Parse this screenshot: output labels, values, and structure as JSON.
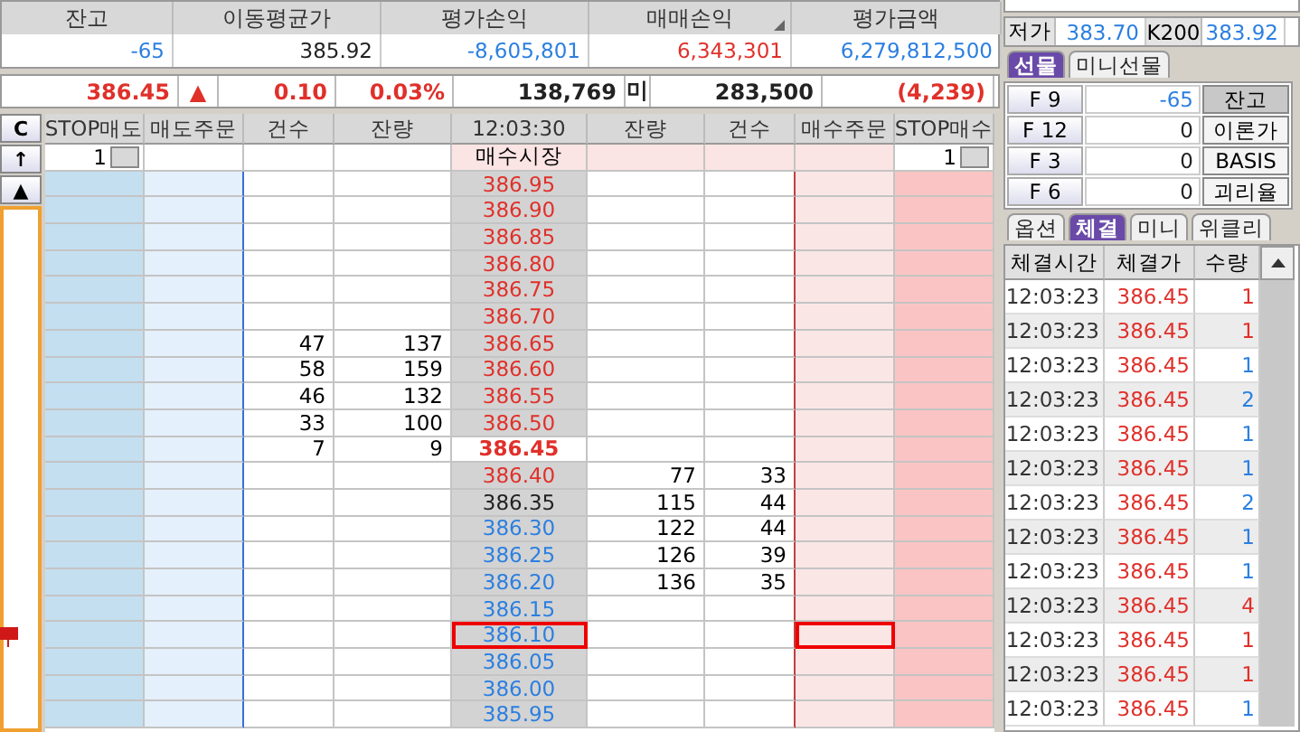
{
  "summary": {
    "columns": [
      {
        "label": "잔고",
        "value": "-65",
        "color": "#2b7fe0",
        "marked": false
      },
      {
        "label": "이동평균가",
        "value": "385.92",
        "color": "#222222",
        "marked": false
      },
      {
        "label": "평가손익",
        "value": "-8,605,801",
        "color": "#2b7fe0",
        "marked": false
      },
      {
        "label": "매매손익",
        "value": "6,343,301",
        "color": "#e0302a",
        "marked": true
      },
      {
        "label": "평가금액",
        "value": "6,279,812,500",
        "color": "#2b7fe0",
        "marked": false
      }
    ]
  },
  "quote": [
    {
      "text": "386.45",
      "color": "#e0302a"
    },
    {
      "text": "▲",
      "color": "#e0302a"
    },
    {
      "text": "0.10",
      "color": "#e0302a"
    },
    {
      "text": "0.03%",
      "color": "#e0302a"
    },
    {
      "text": "138,769",
      "color": "#222222"
    },
    {
      "text": "미",
      "color": "#222222"
    },
    {
      "text": "283,500",
      "color": "#222222"
    },
    {
      "text": "(4,239)",
      "color": "#e0302a"
    }
  ],
  "book": {
    "rail": {
      "clear": "C",
      "up": "↑",
      "top": "▲"
    },
    "columns": [
      "STOP매도",
      "매도주문",
      "건수",
      "잔량",
      "12:03:30",
      "잔량",
      "건수",
      "매수주문",
      "STOP매수"
    ],
    "stop_sell_qty": "1",
    "market_label": "매수시장",
    "stop_buy_qty": "1",
    "rows": [
      {
        "price": "386.95",
        "color": "#e0302a",
        "kind": "ask",
        "selected": false
      },
      {
        "price": "386.90",
        "color": "#e0302a",
        "kind": "ask",
        "selected": false
      },
      {
        "price": "386.85",
        "color": "#e0302a",
        "kind": "ask",
        "selected": false
      },
      {
        "price": "386.80",
        "color": "#e0302a",
        "kind": "ask",
        "selected": false
      },
      {
        "price": "386.75",
        "color": "#e0302a",
        "kind": "ask",
        "selected": false
      },
      {
        "price": "386.70",
        "color": "#e0302a",
        "kind": "ask",
        "selected": false
      },
      {
        "price": "386.65",
        "color": "#e0302a",
        "kind": "ask",
        "selected": false,
        "sell_count": "47",
        "sell_qty": "137"
      },
      {
        "price": "386.60",
        "color": "#e0302a",
        "kind": "ask",
        "selected": false,
        "sell_count": "58",
        "sell_qty": "159"
      },
      {
        "price": "386.55",
        "color": "#e0302a",
        "kind": "ask",
        "selected": false,
        "sell_count": "46",
        "sell_qty": "132"
      },
      {
        "price": "386.50",
        "color": "#e0302a",
        "kind": "ask",
        "selected": false,
        "sell_count": "33",
        "sell_qty": "100"
      },
      {
        "price": "386.45",
        "color": "#e0302a",
        "kind": "current",
        "selected": false,
        "sell_count": "7",
        "sell_qty": "9"
      },
      {
        "price": "386.40",
        "color": "#e0302a",
        "kind": "bid",
        "selected": false,
        "buy_qty": "77",
        "buy_count": "33"
      },
      {
        "price": "386.35",
        "color": "#222222",
        "kind": "bid",
        "selected": false,
        "buy_qty": "115",
        "buy_count": "44"
      },
      {
        "price": "386.30",
        "color": "#2b7fe0",
        "kind": "bid",
        "selected": false,
        "buy_qty": "122",
        "buy_count": "44"
      },
      {
        "price": "386.25",
        "color": "#2b7fe0",
        "kind": "bid",
        "selected": false,
        "buy_qty": "126",
        "buy_count": "39"
      },
      {
        "price": "386.20",
        "color": "#2b7fe0",
        "kind": "bid",
        "selected": false,
        "buy_qty": "136",
        "buy_count": "35"
      },
      {
        "price": "386.15",
        "color": "#2b7fe0",
        "kind": "bid",
        "selected": false
      },
      {
        "price": "386.10",
        "color": "#2b7fe0",
        "kind": "bid",
        "selected": true
      },
      {
        "price": "386.05",
        "color": "#2b7fe0",
        "kind": "bid",
        "selected": false
      },
      {
        "price": "386.00",
        "color": "#2b7fe0",
        "kind": "bid",
        "selected": false
      },
      {
        "price": "385.95",
        "color": "#2b7fe0",
        "kind": "bid",
        "selected": false
      }
    ]
  },
  "side_panel": {
    "low": {
      "label": "저가",
      "value": "383.70",
      "index_label": "K200",
      "index_value": "383.92"
    },
    "futures_tabs": [
      {
        "label": "선물",
        "selected": true
      },
      {
        "label": "미니선물",
        "selected": false
      }
    ],
    "contracts": [
      {
        "key": "F 9",
        "value": "-65",
        "color": "#2b7fe0",
        "action": "잔고",
        "pressed": true
      },
      {
        "key": "F 12",
        "value": "0",
        "color": "#222222",
        "action": "이론가",
        "pressed": false
      },
      {
        "key": "F 3",
        "value": "0",
        "color": "#222222",
        "action": "BASIS",
        "pressed": false
      },
      {
        "key": "F 6",
        "value": "0",
        "color": "#222222",
        "action": "괴리율",
        "pressed": false
      }
    ],
    "trade_tabs": [
      {
        "label": "옵션",
        "selected": false
      },
      {
        "label": "체결",
        "selected": true
      },
      {
        "label": "미니",
        "selected": false
      },
      {
        "label": "위클리",
        "selected": false
      }
    ],
    "trade_columns": [
      "체결시간",
      "체결가",
      "수량"
    ],
    "trades": [
      {
        "time": "12:03:23",
        "price": "386.45",
        "qty": "1",
        "color": "#e0302a"
      },
      {
        "time": "12:03:23",
        "price": "386.45",
        "qty": "1",
        "color": "#e0302a"
      },
      {
        "time": "12:03:23",
        "price": "386.45",
        "qty": "1",
        "color": "#2b7fe0"
      },
      {
        "time": "12:03:23",
        "price": "386.45",
        "qty": "2",
        "color": "#2b7fe0"
      },
      {
        "time": "12:03:23",
        "price": "386.45",
        "qty": "1",
        "color": "#2b7fe0"
      },
      {
        "time": "12:03:23",
        "price": "386.45",
        "qty": "1",
        "color": "#2b7fe0"
      },
      {
        "time": "12:03:23",
        "price": "386.45",
        "qty": "2",
        "color": "#2b7fe0"
      },
      {
        "time": "12:03:23",
        "price": "386.45",
        "qty": "1",
        "color": "#2b7fe0"
      },
      {
        "time": "12:03:23",
        "price": "386.45",
        "qty": "1",
        "color": "#2b7fe0"
      },
      {
        "time": "12:03:23",
        "price": "386.45",
        "qty": "4",
        "color": "#e0302a"
      },
      {
        "time": "12:03:23",
        "price": "386.45",
        "qty": "1",
        "color": "#e0302a"
      },
      {
        "time": "12:03:23",
        "price": "386.45",
        "qty": "1",
        "color": "#e0302a"
      },
      {
        "time": "12:03:23",
        "price": "386.45",
        "qty": "1",
        "color": "#2b7fe0"
      }
    ]
  }
}
